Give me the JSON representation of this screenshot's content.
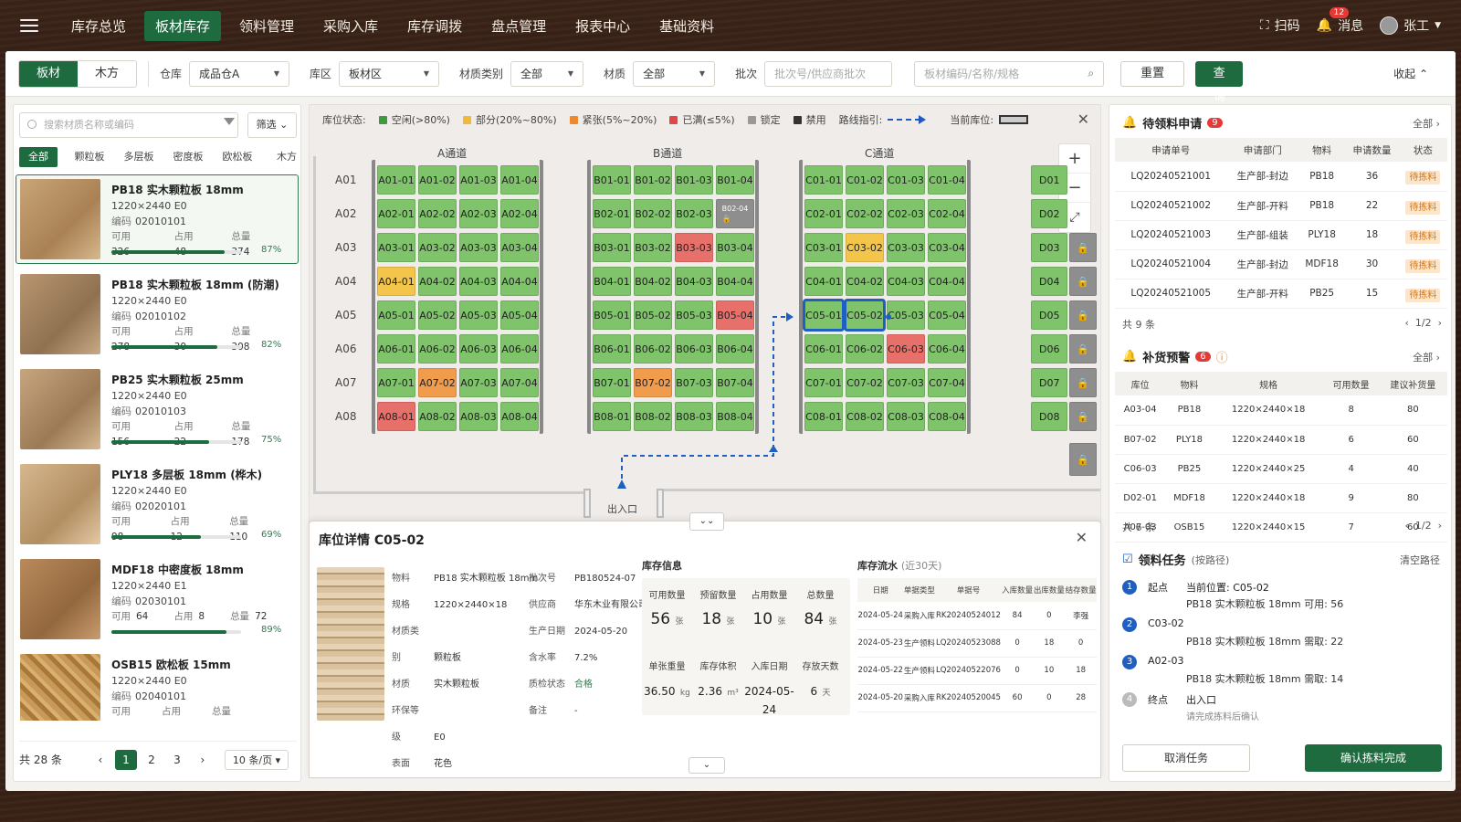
{
  "nav": {
    "items": [
      "库存总览",
      "板材库存",
      "领料管理",
      "采购入库",
      "库存调拨",
      "盘点管理",
      "报表中心",
      "基础资料"
    ],
    "active": 1,
    "scan": "扫码",
    "messages": "消息",
    "msg_count": "12",
    "user": "张工"
  },
  "filters": {
    "tab_board": "板材",
    "tab_wood": "木方",
    "warehouse_label": "仓库",
    "warehouse": "成品仓A",
    "zone_label": "库区",
    "zone": "板材区",
    "cat_label": "材质类别",
    "cat": "全部",
    "mat_label": "材质",
    "mat": "全部",
    "batch_label": "批次",
    "batch_ph": "批次号/供应商批次",
    "search_ph": "板材编码/名称/规格",
    "reset": "重置",
    "query": "查询",
    "collapse": "收起"
  },
  "left": {
    "search_ph": "搜索材质名称或编码",
    "filter": "筛选",
    "tabs": [
      "全部",
      "颗粒板",
      "多层板",
      "密度板",
      "欧松板",
      "木方"
    ],
    "items": [
      {
        "name": "PB18  实木颗粒板 18mm",
        "spec": "1220×2440  E0",
        "code": "02010101",
        "avail": "326",
        "occ": "48",
        "total": "374",
        "pct": "87%",
        "p": 0.87
      },
      {
        "name": "PB18  实木颗粒板 18mm (防潮)",
        "spec": "1220×2440  E0",
        "code": "02010102",
        "avail": "278",
        "occ": "30",
        "total": "308",
        "pct": "82%",
        "p": 0.82
      },
      {
        "name": "PB25  实木颗粒板 25mm",
        "spec": "1220×2440  E0",
        "code": "02010103",
        "avail": "156",
        "occ": "22",
        "total": "178",
        "pct": "75%",
        "p": 0.75
      },
      {
        "name": "PLY18  多层板 18mm (桦木)",
        "spec": "1220×2440  E0",
        "code": "02020101",
        "avail": "98",
        "occ": "12",
        "total": "110",
        "pct": "69%",
        "p": 0.69
      },
      {
        "name": "MDF18  中密度板 18mm",
        "spec": "1220×2440  E1",
        "code": "02030101",
        "avail": "64",
        "occ": "8",
        "total": "72",
        "pct": "89%",
        "p": 0.89
      },
      {
        "name": "OSB15  欧松板 15mm",
        "spec": "1220×2440  E0",
        "code": "02040101",
        "avail": "",
        "occ": "",
        "total": "",
        "pct": "",
        "p": 0
      }
    ],
    "labels": {
      "code": "编码",
      "avail": "可用",
      "occ": "占用",
      "total": "总量"
    },
    "total": "共 28 条",
    "pages": [
      "1",
      "2",
      "3"
    ],
    "pagesize": "10 条/页"
  },
  "map": {
    "legend_title": "库位状态:",
    "legend": [
      {
        "t": "空闲(>80%)",
        "c": "#3f9a3f"
      },
      {
        "t": "部分(20%~80%)",
        "c": "#f0b93a"
      },
      {
        "t": "紧张(5%~20%)",
        "c": "#ee8a2e"
      },
      {
        "t": "已满(≤5%)",
        "c": "#e04848"
      },
      {
        "t": "锁定",
        "c": "#999999"
      },
      {
        "t": "禁用",
        "c": "#333333"
      }
    ],
    "route": "路线指引:",
    "current": "当前库位:",
    "aisles": [
      "A通道",
      "B通道",
      "C通道"
    ],
    "rows": [
      "A01",
      "A02",
      "A03",
      "A04",
      "A05",
      "A06",
      "A07",
      "A08"
    ],
    "entrance": "出入口",
    "drow": [
      "D01",
      "D02",
      "D03",
      "D04",
      "D05",
      "D06",
      "D07",
      "D08"
    ]
  },
  "detail": {
    "title": "库位详情  C05-02",
    "p1": [
      [
        "物料",
        "PB18 实木颗粒板 18mm"
      ],
      [
        "规格",
        "1220×2440×18"
      ],
      [
        "材质类别",
        "颗粒板"
      ],
      [
        "材质",
        "实木颗粒板"
      ],
      [
        "环保等级",
        "E0"
      ],
      [
        "表面",
        "花色"
      ]
    ],
    "p2": [
      [
        "批次号",
        "PB180524-07"
      ],
      [
        "供应商",
        "华东木业有限公司"
      ],
      [
        "生产日期",
        "2024-05-20"
      ],
      [
        "含水率",
        "7.2%"
      ],
      [
        "质检状态",
        "合格"
      ],
      [
        "备注",
        "-"
      ]
    ],
    "stock_title": "库存信息",
    "stock": [
      {
        "k": "可用数量",
        "v": "56",
        "u": "张"
      },
      {
        "k": "预留数量",
        "v": "18",
        "u": "张"
      },
      {
        "k": "占用数量",
        "v": "10",
        "u": "张"
      },
      {
        "k": "总数量",
        "v": "84",
        "u": "张"
      }
    ],
    "stock2": [
      {
        "k": "单张重量",
        "v": "36.50",
        "u": "kg"
      },
      {
        "k": "库存体积",
        "v": "2.36",
        "u": "m³"
      },
      {
        "k": "入库日期",
        "v": "2024-05-24",
        "u": ""
      },
      {
        "k": "存放天数",
        "v": "6",
        "u": "天"
      }
    ],
    "flow_title": "库存流水",
    "flow_sub": "(近30天)",
    "flow_head": [
      "日期",
      "单据类型",
      "单据号",
      "入库数量",
      "出库数量",
      "结存数量"
    ],
    "flow": [
      [
        "2024-05-24",
        "采购入库",
        "RK20240524012",
        "84",
        "0",
        "李强"
      ],
      [
        "2024-05-23",
        "生产领料",
        "LQ20240523088",
        "0",
        "18",
        "0"
      ],
      [
        "2024-05-22",
        "生产领料",
        "LQ20240522076",
        "0",
        "10",
        "18"
      ],
      [
        "2024-05-20",
        "采购入库",
        "RK20240520045",
        "60",
        "0",
        "28"
      ]
    ]
  },
  "right": {
    "req_title": "待领料申请",
    "req_count": "9",
    "all": "全部",
    "req_head": [
      "申请单号",
      "申请部门",
      "物料",
      "申请数量",
      "状态"
    ],
    "req": [
      [
        "LQ20240521001",
        "生产部-封边",
        "PB18",
        "36",
        "待拣料"
      ],
      [
        "LQ20240521002",
        "生产部-开料",
        "PB18",
        "22",
        "待拣料"
      ],
      [
        "LQ20240521003",
        "生产部-组装",
        "PLY18",
        "18",
        "待拣料"
      ],
      [
        "LQ20240521004",
        "生产部-封边",
        "MDF18",
        "30",
        "待拣料"
      ],
      [
        "LQ20240521005",
        "生产部-开料",
        "PB25",
        "15",
        "待拣料"
      ]
    ],
    "req_total": "共 9 条",
    "req_page": "1/2",
    "warn_title": "补货预警",
    "warn_count": "6",
    "warn_head": [
      "库位",
      "物料",
      "规格",
      "可用数量",
      "建议补货量"
    ],
    "warn": [
      [
        "A03-04",
        "PB18",
        "1220×2440×18",
        "8",
        "80"
      ],
      [
        "B07-02",
        "PLY18",
        "1220×2440×18",
        "6",
        "60"
      ],
      [
        "C06-03",
        "PB25",
        "1220×2440×25",
        "4",
        "40"
      ],
      [
        "D02-01",
        "MDF18",
        "1220×2440×18",
        "9",
        "80"
      ],
      [
        "A07-03",
        "OSB15",
        "1220×2440×15",
        "7",
        "60"
      ]
    ],
    "warn_total": "共 6 条",
    "warn_page": "1/2",
    "task_title": "领料任务",
    "task_sub": "(按路径)",
    "clear": "清空路径",
    "tasks": [
      {
        "n": "1",
        "a": "起点",
        "b": "当前位置: C05-02",
        "c": "PB18  实木颗粒板 18mm   可用: 56"
      },
      {
        "n": "2",
        "a": "C03-02",
        "b": "",
        "c": "PB18  实木颗粒板 18mm   需取: 22"
      },
      {
        "n": "3",
        "a": "A02-03",
        "b": "",
        "c": "PB18  实木颗粒板 18mm   需取: 14"
      },
      {
        "n": "4",
        "a": "终点",
        "b": "出入口",
        "c": "请完成拣料后确认"
      }
    ],
    "cancel": "取消任务",
    "confirm": "确认拣料完成"
  }
}
